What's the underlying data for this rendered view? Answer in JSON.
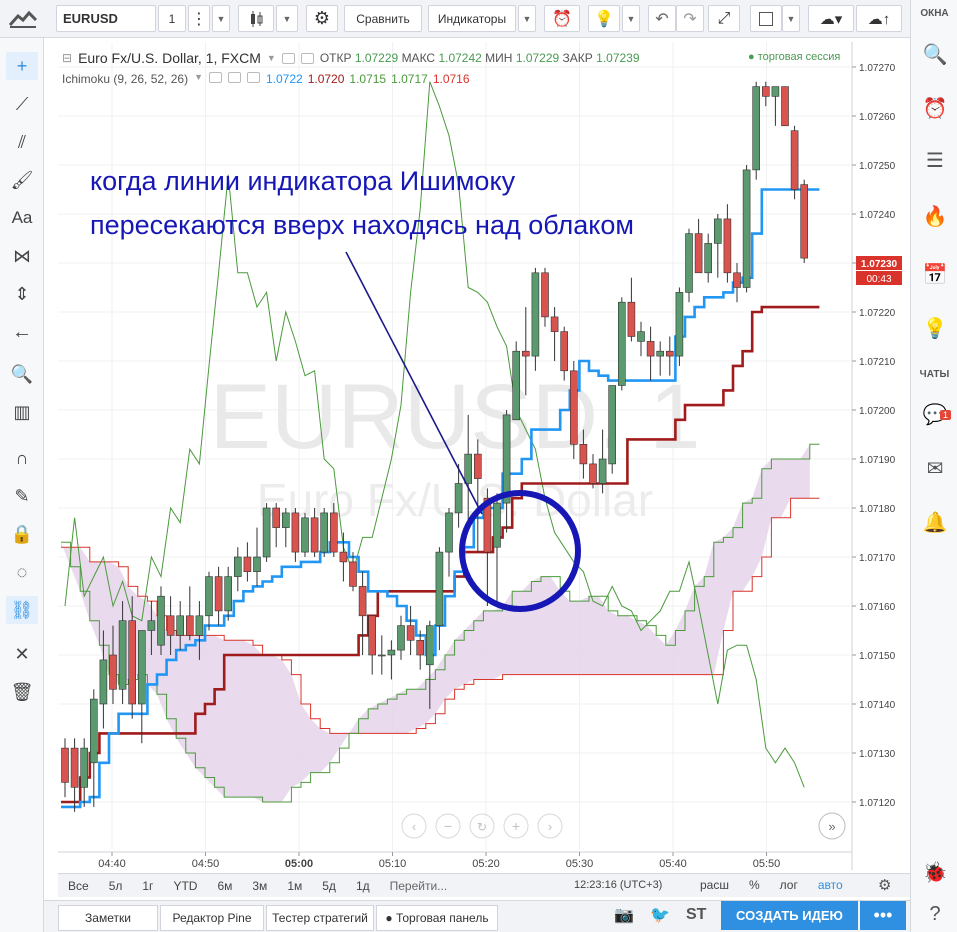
{
  "toolbar": {
    "symbol": "EURUSD",
    "interval": "1",
    "compare_label": "Сравнить",
    "indicators_label": "Индикаторы"
  },
  "legend": {
    "title": "Euro Fx/U.S. Dollar, 1, FXCM",
    "open_label": "ОТКР",
    "open": "1.07229",
    "high_label": "МАКС",
    "high": "1.07242",
    "low_label": "МИН",
    "low": "1.07229",
    "close_label": "ЗАКР",
    "close": "1.07239",
    "session": "торговая сессия",
    "indicator_name": "Ichimoku (9, 26, 52, 26)",
    "ind_values": [
      {
        "value": "1.0722",
        "color": "#2196f3"
      },
      {
        "value": "1.0720",
        "color": "#a01b1b"
      },
      {
        "value": "1.0715",
        "color": "#4a9a3b"
      },
      {
        "value": "1.0717",
        "color": "#4a9a3b"
      },
      {
        "value": "1.0716",
        "color": "#d9342b"
      }
    ]
  },
  "watermark": {
    "main": "EURUSD, 1",
    "sub": "Euro Fx/U.S. Dollar"
  },
  "annotation": {
    "line1": "когда линии индикатора Ишимоку",
    "line2": "пересекаются вверх находясь над облаком"
  },
  "price_tags": {
    "current": "1.07230",
    "countdown": "00:43"
  },
  "bottom_bar": {
    "ranges": [
      "Все",
      "5л",
      "1г",
      "YTD",
      "6м",
      "3м",
      "1м",
      "5д",
      "1д",
      "Перейти..."
    ],
    "clock": "12:23:16 (UTC+3)",
    "options": [
      "расш",
      "%",
      "лог",
      "авто"
    ]
  },
  "footer": {
    "tabs": [
      "Заметки",
      "Редактор Pine",
      "Тестер стратегий",
      "Торговая панель"
    ],
    "create_idea": "СОЗДАТЬ ИДЕЮ",
    "more": "•••",
    "st_label": "ST"
  },
  "right_panel": {
    "windows_label": "ОКНА",
    "chats_label": "ЧАТЫ",
    "badge": "1"
  },
  "chart_data": {
    "type": "candlestick",
    "symbol": "EURUSD",
    "timeframe": "1",
    "x_tick_labels": [
      "04:40",
      "04:50",
      "05:00",
      "05:10",
      "05:20",
      "05:30",
      "05:40",
      "05:50"
    ],
    "y_tick_labels": [
      "1.07120",
      "1.07130",
      "1.07140",
      "1.07150",
      "1.07160",
      "1.07170",
      "1.07180",
      "1.07190",
      "1.07200",
      "1.07210",
      "1.07220",
      "1.07230",
      "1.07240",
      "1.07250",
      "1.07260",
      "1.07270"
    ],
    "ylim": [
      1.07116,
      1.07273
    ],
    "colors": {
      "up": "#5a9a6e",
      "down": "#d9534f",
      "tenkan": "#2196f3",
      "kijun": "#a01b1b",
      "span_a": "#d9342b",
      "span_b": "#4a9a3b",
      "chikou": "#4a9a3b",
      "cloud": "#e5d5ea"
    },
    "candles": [
      {
        "o": 1.07131,
        "h": 1.07133,
        "l": 1.07121,
        "c": 1.07124
      },
      {
        "o": 1.07131,
        "h": 1.07133,
        "l": 1.07118,
        "c": 1.07123
      },
      {
        "o": 1.07123,
        "h": 1.07133,
        "l": 1.07119,
        "c": 1.07131
      },
      {
        "o": 1.07128,
        "h": 1.07143,
        "l": 1.07119,
        "c": 1.07141
      },
      {
        "o": 1.0714,
        "h": 1.07155,
        "l": 1.07135,
        "c": 1.07149
      },
      {
        "o": 1.0715,
        "h": 1.07156,
        "l": 1.0714,
        "c": 1.07143
      },
      {
        "o": 1.07143,
        "h": 1.07161,
        "l": 1.0714,
        "c": 1.07157
      },
      {
        "o": 1.07157,
        "h": 1.07162,
        "l": 1.07137,
        "c": 1.0714
      },
      {
        "o": 1.0714,
        "h": 1.07155,
        "l": 1.07132,
        "c": 1.07155
      },
      {
        "o": 1.07155,
        "h": 1.07161,
        "l": 1.0715,
        "c": 1.07157
      },
      {
        "o": 1.07152,
        "h": 1.07164,
        "l": 1.0715,
        "c": 1.07162
      },
      {
        "o": 1.07158,
        "h": 1.07162,
        "l": 1.0715,
        "c": 1.07154
      },
      {
        "o": 1.07154,
        "h": 1.07161,
        "l": 1.07151,
        "c": 1.07158
      },
      {
        "o": 1.07158,
        "h": 1.07164,
        "l": 1.07153,
        "c": 1.07154
      },
      {
        "o": 1.07154,
        "h": 1.07161,
        "l": 1.07149,
        "c": 1.07158
      },
      {
        "o": 1.07158,
        "h": 1.07167,
        "l": 1.07155,
        "c": 1.07166
      },
      {
        "o": 1.07166,
        "h": 1.07168,
        "l": 1.07156,
        "c": 1.07159
      },
      {
        "o": 1.07159,
        "h": 1.07168,
        "l": 1.07157,
        "c": 1.07166
      },
      {
        "o": 1.07166,
        "h": 1.07172,
        "l": 1.07163,
        "c": 1.0717
      },
      {
        "o": 1.0717,
        "h": 1.07173,
        "l": 1.07165,
        "c": 1.07167
      },
      {
        "o": 1.07167,
        "h": 1.07176,
        "l": 1.07164,
        "c": 1.0717
      },
      {
        "o": 1.0717,
        "h": 1.07181,
        "l": 1.07169,
        "c": 1.0718
      },
      {
        "o": 1.0718,
        "h": 1.07181,
        "l": 1.07172,
        "c": 1.07176
      },
      {
        "o": 1.07176,
        "h": 1.0718,
        "l": 1.07172,
        "c": 1.07179
      },
      {
        "o": 1.07179,
        "h": 1.0718,
        "l": 1.07169,
        "c": 1.07171
      },
      {
        "o": 1.07171,
        "h": 1.07179,
        "l": 1.0717,
        "c": 1.07178
      },
      {
        "o": 1.07178,
        "h": 1.0718,
        "l": 1.0717,
        "c": 1.07171
      },
      {
        "o": 1.07171,
        "h": 1.0718,
        "l": 1.0717,
        "c": 1.07179
      },
      {
        "o": 1.07179,
        "h": 1.07181,
        "l": 1.0717,
        "c": 1.07171
      },
      {
        "o": 1.07171,
        "h": 1.07175,
        "l": 1.07165,
        "c": 1.07169
      },
      {
        "o": 1.07169,
        "h": 1.07171,
        "l": 1.07163,
        "c": 1.07164
      },
      {
        "o": 1.07164,
        "h": 1.07167,
        "l": 1.0715,
        "c": 1.07158
      },
      {
        "o": 1.07158,
        "h": 1.07158,
        "l": 1.07146,
        "c": 1.0715
      },
      {
        "o": 1.0715,
        "h": 1.07154,
        "l": 1.07146,
        "c": 1.0715
      },
      {
        "o": 1.0715,
        "h": 1.07153,
        "l": 1.07145,
        "c": 1.07151
      },
      {
        "o": 1.07151,
        "h": 1.07158,
        "l": 1.07149,
        "c": 1.07156
      },
      {
        "o": 1.07156,
        "h": 1.0716,
        "l": 1.0715,
        "c": 1.07153
      },
      {
        "o": 1.07153,
        "h": 1.07155,
        "l": 1.07147,
        "c": 1.0715
      },
      {
        "o": 1.07148,
        "h": 1.07157,
        "l": 1.07139,
        "c": 1.07156
      },
      {
        "o": 1.07156,
        "h": 1.07172,
        "l": 1.07151,
        "c": 1.07171
      },
      {
        "o": 1.07171,
        "h": 1.0718,
        "l": 1.07166,
        "c": 1.07179
      },
      {
        "o": 1.07179,
        "h": 1.07189,
        "l": 1.07176,
        "c": 1.07185
      },
      {
        "o": 1.07185,
        "h": 1.07199,
        "l": 1.07176,
        "c": 1.07191
      },
      {
        "o": 1.07191,
        "h": 1.07194,
        "l": 1.07171,
        "c": 1.07186
      },
      {
        "o": 1.07182,
        "h": 1.07184,
        "l": 1.0716,
        "c": 1.07171
      },
      {
        "o": 1.07172,
        "h": 1.07183,
        "l": 1.07161,
        "c": 1.07181
      },
      {
        "o": 1.07181,
        "h": 1.072,
        "l": 1.07175,
        "c": 1.07199
      },
      {
        "o": 1.07198,
        "h": 1.07214,
        "l": 1.07198,
        "c": 1.07212
      },
      {
        "o": 1.07212,
        "h": 1.07221,
        "l": 1.07203,
        "c": 1.07211
      },
      {
        "o": 1.07211,
        "h": 1.07229,
        "l": 1.07208,
        "c": 1.07228
      },
      {
        "o": 1.07228,
        "h": 1.07229,
        "l": 1.07217,
        "c": 1.07219
      },
      {
        "o": 1.07219,
        "h": 1.07221,
        "l": 1.0721,
        "c": 1.07216
      },
      {
        "o": 1.07216,
        "h": 1.07217,
        "l": 1.07206,
        "c": 1.07208
      },
      {
        "o": 1.07208,
        "h": 1.0721,
        "l": 1.0719,
        "c": 1.07193
      },
      {
        "o": 1.07193,
        "h": 1.07196,
        "l": 1.07186,
        "c": 1.07189
      },
      {
        "o": 1.07189,
        "h": 1.07191,
        "l": 1.07184,
        "c": 1.07185
      },
      {
        "o": 1.07185,
        "h": 1.07196,
        "l": 1.07183,
        "c": 1.0719
      },
      {
        "o": 1.07189,
        "h": 1.07205,
        "l": 1.07187,
        "c": 1.07205
      },
      {
        "o": 1.07205,
        "h": 1.07223,
        "l": 1.07204,
        "c": 1.07222
      },
      {
        "o": 1.07222,
        "h": 1.07227,
        "l": 1.07214,
        "c": 1.07215
      },
      {
        "o": 1.07214,
        "h": 1.07218,
        "l": 1.07211,
        "c": 1.07216
      },
      {
        "o": 1.07214,
        "h": 1.07217,
        "l": 1.07206,
        "c": 1.07211
      },
      {
        "o": 1.07211,
        "h": 1.07214,
        "l": 1.07207,
        "c": 1.07212
      },
      {
        "o": 1.07212,
        "h": 1.07215,
        "l": 1.07207,
        "c": 1.07211
      },
      {
        "o": 1.07211,
        "h": 1.07225,
        "l": 1.07209,
        "c": 1.07224
      },
      {
        "o": 1.07224,
        "h": 1.07237,
        "l": 1.07222,
        "c": 1.07236
      },
      {
        "o": 1.07236,
        "h": 1.07239,
        "l": 1.07228,
        "c": 1.07228
      },
      {
        "o": 1.07228,
        "h": 1.07236,
        "l": 1.07226,
        "c": 1.07234
      },
      {
        "o": 1.07234,
        "h": 1.0724,
        "l": 1.07227,
        "c": 1.07239
      },
      {
        "o": 1.07239,
        "h": 1.07242,
        "l": 1.07226,
        "c": 1.07228
      },
      {
        "o": 1.07228,
        "h": 1.0723,
        "l": 1.07222,
        "c": 1.07225
      },
      {
        "o": 1.07225,
        "h": 1.0725,
        "l": 1.07224,
        "c": 1.07249
      },
      {
        "o": 1.07249,
        "h": 1.07267,
        "l": 1.07247,
        "c": 1.07266
      },
      {
        "o": 1.07266,
        "h": 1.07267,
        "l": 1.07262,
        "c": 1.07264
      },
      {
        "o": 1.07264,
        "h": 1.07266,
        "l": 1.07258,
        "c": 1.07266
      },
      {
        "o": 1.07266,
        "h": 1.07266,
        "l": 1.07258,
        "c": 1.07258
      },
      {
        "o": 1.07257,
        "h": 1.07258,
        "l": 1.07243,
        "c": 1.07245
      },
      {
        "o": 1.07246,
        "h": 1.07247,
        "l": 1.0723,
        "c": 1.07231
      }
    ],
    "tenkan": [
      1.07119,
      1.07119,
      1.0712,
      1.07121,
      1.07128,
      1.07134,
      1.07138,
      1.07138,
      1.07138,
      1.07144,
      1.07146,
      1.07149,
      1.07151,
      1.07152,
      1.07153,
      1.07156,
      1.07156,
      1.07158,
      1.07161,
      1.07163,
      1.07164,
      1.07165,
      1.07166,
      1.07168,
      1.07168,
      1.07169,
      1.07169,
      1.07171,
      1.07173,
      1.07173,
      1.0717,
      1.07167,
      1.07163,
      1.07163,
      1.07162,
      1.0716,
      1.07157,
      1.07154,
      1.0715,
      1.07156,
      1.07162,
      1.07167,
      1.07172,
      1.07178,
      1.0718,
      1.0718,
      1.07187,
      1.07187,
      1.0719,
      1.07196,
      1.07196,
      1.07196,
      1.072,
      1.07204,
      1.0721,
      1.07208,
      1.07207,
      1.07206,
      1.07206,
      1.07206,
      1.07206,
      1.07206,
      1.07206,
      1.07206,
      1.07215,
      1.07219,
      1.07221,
      1.07223,
      1.07223,
      1.07224,
      1.07226,
      1.07227,
      1.07236,
      1.07245,
      1.07245,
      1.07245,
      1.07245,
      1.07245,
      1.07245
    ],
    "kijun": [
      1.0712,
      1.0712,
      1.07125,
      1.0713,
      1.07134,
      1.07134,
      1.07134,
      1.07134,
      1.07134,
      1.07134,
      1.07134,
      1.07134,
      1.07134,
      1.07134,
      1.07138,
      1.0714,
      1.07143,
      1.0715,
      1.0715,
      1.0715,
      1.0715,
      1.0715,
      1.0715,
      1.0715,
      1.0715,
      1.0715,
      1.0715,
      1.0715,
      1.0715,
      1.0715,
      1.0715,
      1.07154,
      1.07158,
      1.07163,
      1.07163,
      1.07163,
      1.07163,
      1.07163,
      1.07163,
      1.07163,
      1.07163,
      1.07166,
      1.07171,
      1.07171,
      1.07171,
      1.07174,
      1.07176,
      1.07182,
      1.07185,
      1.07185,
      1.07185,
      1.07185,
      1.07185,
      1.07185,
      1.07185,
      1.07185,
      1.07185,
      1.07185,
      1.07185,
      1.07194,
      1.07194,
      1.07194,
      1.07194,
      1.07194,
      1.07198,
      1.07201,
      1.07201,
      1.07201,
      1.07201,
      1.07204,
      1.07209,
      1.07212,
      1.0722,
      1.07221,
      1.07221,
      1.07221,
      1.07221,
      1.07221,
      1.07221
    ],
    "span_a": [
      1.07172,
      1.07172,
      1.07172,
      1.07169,
      1.07169,
      1.07169,
      1.07168,
      1.07164,
      1.07162,
      1.07161,
      1.07158,
      1.07155,
      1.07154,
      1.07154,
      1.07154,
      1.07154,
      1.07154,
      1.07153,
      1.07153,
      1.07153,
      1.07152,
      1.0715,
      1.0715,
      1.07149,
      1.07146,
      1.0714,
      1.07137,
      1.07135,
      1.07134,
      1.07134,
      1.07134,
      1.07134,
      1.07134,
      1.07134,
      1.07134,
      1.07134,
      1.07134,
      1.07135,
      1.07136,
      1.07138,
      1.07141,
      1.07143,
      1.07144,
      1.07145,
      1.07145,
      1.07145,
      1.07146,
      1.07146,
      1.07146,
      1.07146,
      1.07146,
      1.07146,
      1.07146,
      1.07146,
      1.07146,
      1.07146,
      1.07146,
      1.07146,
      1.07146,
      1.07146,
      1.07146,
      1.07146,
      1.07146,
      1.07146,
      1.07146,
      1.07146,
      1.07146,
      1.07146,
      1.07146,
      1.07155,
      1.07163,
      1.07163,
      1.07166,
      1.0717,
      1.07178,
      1.07178,
      1.07182,
      1.07182,
      1.07182
    ],
    "span_b": [
      1.07173,
      1.07168,
      1.07163,
      1.07157,
      1.07152,
      1.07146,
      1.07144,
      1.07145,
      1.07146,
      1.07144,
      1.07142,
      1.07137,
      1.07133,
      1.0713,
      1.07127,
      1.07125,
      1.07123,
      1.07121,
      1.07121,
      1.07121,
      1.07121,
      1.0712,
      1.0712,
      1.0712,
      1.07123,
      1.07124,
      1.07126,
      1.07126,
      1.07128,
      1.07131,
      1.07134,
      1.07137,
      1.07139,
      1.0714,
      1.07141,
      1.07142,
      1.07143,
      1.07143,
      1.07145,
      1.07147,
      1.0715,
      1.07153,
      1.07155,
      1.07157,
      1.07159,
      1.07159,
      1.0716,
      1.07163,
      1.07163,
      1.07165,
      1.07166,
      1.07166,
      1.07163,
      1.07161,
      1.07161,
      1.07162,
      1.07162,
      1.07159,
      1.07158,
      1.07158,
      1.07157,
      1.07156,
      1.07154,
      1.07152,
      1.07155,
      1.07159,
      1.07164,
      1.07166,
      1.07173,
      1.07174,
      1.07176,
      1.07181,
      1.07182,
      1.07188,
      1.0719,
      1.0719,
      1.0719,
      1.0719,
      1.07193
    ],
    "chikou": [
      1.0716,
      1.07178,
      1.07162,
      1.07166,
      1.0717,
      1.0716,
      1.07165,
      1.07158,
      1.07157,
      1.0717,
      1.07166,
      1.0718,
      1.07177,
      1.07192,
      1.07189,
      1.07209,
      1.07228,
      1.07248,
      1.07228,
      1.07228,
      1.07221,
      1.07224,
      1.0721,
      1.0722,
      1.07214,
      1.07207,
      1.07208,
      1.0719,
      1.07188,
      1.07172,
      1.07167,
      1.07174,
      1.07174,
      1.07182,
      1.0719,
      1.07201,
      1.07224,
      1.07241,
      1.07267,
      1.07262,
      1.07256,
      1.07246,
      1.07225,
      1.07224,
      1.07222,
      1.07217,
      1.07213,
      1.072,
      1.07196,
      1.07192,
      1.07182,
      1.07175,
      1.07172,
      1.07169,
      1.07167,
      1.07161,
      1.0716,
      1.07164,
      1.0716,
      1.07159,
      1.07155,
      1.07157,
      1.07159,
      1.07163,
      1.07163,
      1.07169,
      1.0716,
      1.0715,
      1.0714,
      1.07151,
      1.07152,
      1.07152,
      1.07145,
      1.07131,
      1.07128,
      1.07131,
      1.07128,
      1.07123
    ]
  }
}
